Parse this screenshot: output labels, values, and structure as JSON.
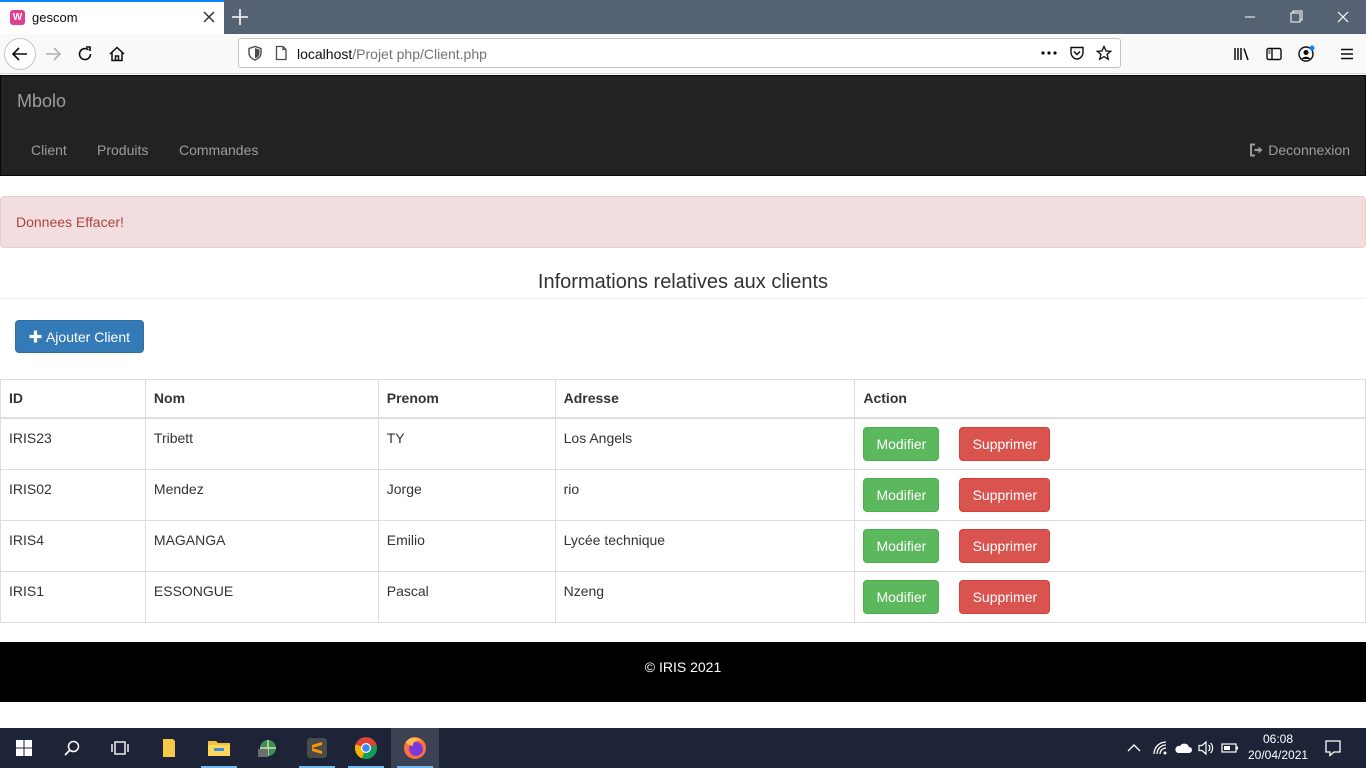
{
  "browser": {
    "tab_title": "gescom",
    "favicon_letter": "W",
    "url_host": "localhost",
    "url_path": "/Projet php/Client.php"
  },
  "site": {
    "brand": "Mbolo",
    "nav": [
      "Client",
      "Produits",
      "Commandes"
    ],
    "logout": "Deconnexion"
  },
  "alert": {
    "text": "Donnees Effacer!"
  },
  "page": {
    "heading": "Informations relatives aux clients",
    "add_button": "Ajouter Client"
  },
  "table": {
    "headers": [
      "ID",
      "Nom",
      "Prenom",
      "Adresse",
      "Action"
    ],
    "rows": [
      {
        "id": "IRIS23",
        "nom": "Tribett",
        "prenom": "TY",
        "adresse": "Los Angels"
      },
      {
        "id": "IRIS02",
        "nom": "Mendez",
        "prenom": "Jorge",
        "adresse": "rio"
      },
      {
        "id": "IRIS4",
        "nom": "MAGANGA",
        "prenom": "Emilio",
        "adresse": "Lycée technique"
      },
      {
        "id": "IRIS1",
        "nom": "ESSONGUE",
        "prenom": "Pascal",
        "adresse": "Nzeng"
      }
    ],
    "modify_label": "Modifier",
    "delete_label": "Supprimer"
  },
  "footer": {
    "text": "© IRIS 2021"
  },
  "taskbar": {
    "time": "06:08",
    "date": "20/04/2021"
  },
  "colors": {
    "primary": "#337ab7",
    "success": "#5cb85c",
    "danger": "#d9534f",
    "alert_bg": "#f2dede",
    "alert_text": "#a94442",
    "navbar_bg": "#222222"
  }
}
